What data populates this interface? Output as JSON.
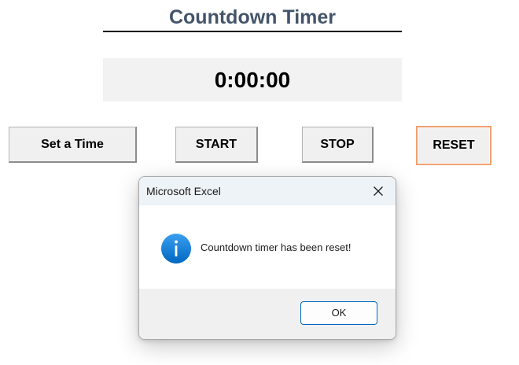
{
  "sheet": {
    "title": "Countdown Timer",
    "timer_display": "0:00:00",
    "buttons": {
      "set_time": "Set a Time",
      "start": "START",
      "stop": "STOP",
      "reset": "RESET"
    }
  },
  "dialog": {
    "title": "Microsoft Excel",
    "message": "Countdown timer has been reset!",
    "icon": "info-icon",
    "ok_label": "OK",
    "close_icon": "close-icon"
  },
  "colors": {
    "title_text": "#44546a",
    "display_bg": "#f2f2f2",
    "reset_outline": "#f0a070",
    "ok_border": "#0067c0",
    "info_icon": "#0078d4"
  }
}
